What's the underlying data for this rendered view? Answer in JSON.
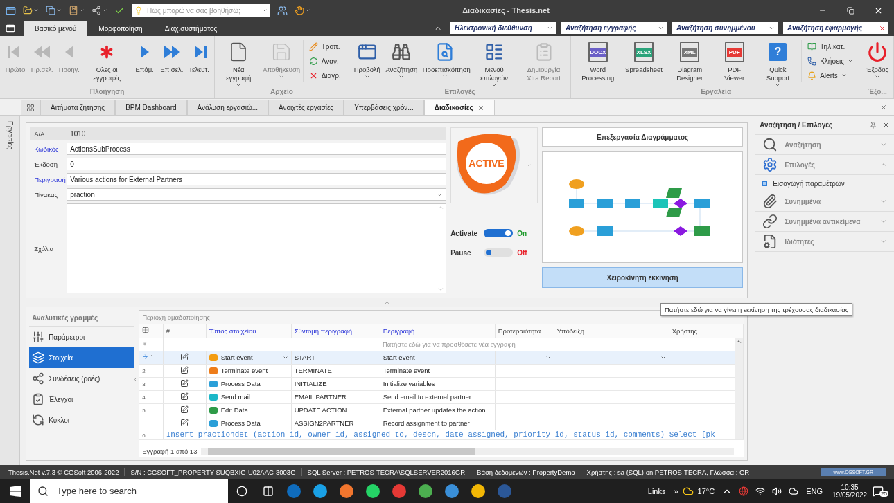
{
  "title_bar": {
    "search": {
      "placeholder": "Πως μπορώ να σας βοηθήσω;"
    },
    "title": "Διαδικασίες - Thesis.net"
  },
  "ribbon_tabs": [
    {
      "label": "Βασικό μενού",
      "selected": true
    },
    {
      "label": "Μορφοποίηση",
      "selected": false
    },
    {
      "label": "Διαχ.συστήματος",
      "selected": false
    }
  ],
  "ribbon_searches": [
    {
      "placeholder": "Ηλεκτρονική διεύθυνση",
      "kind": "dropdown"
    },
    {
      "placeholder": "Αναζήτηση εγγραφής",
      "kind": "dropdown"
    },
    {
      "placeholder": "Αναζήτηση συνημμένου",
      "kind": "dropdown"
    },
    {
      "placeholder": "Αναζήτηση εφαρμογής",
      "kind": "clear"
    }
  ],
  "ribbon_groups": [
    {
      "title": "Πλοήγηση",
      "items": [
        {
          "kind": "large",
          "label": "Πρώτο",
          "disabled": true,
          "dropdown": false
        },
        {
          "kind": "large",
          "label": "Πρ.σελ.",
          "disabled": true,
          "dropdown": false
        },
        {
          "kind": "large",
          "label": "Προηγ.",
          "disabled": true,
          "dropdown": false
        },
        {
          "kind": "large",
          "label": "Όλες οι εγγραφές",
          "disabled": false,
          "dropdown": false
        },
        {
          "kind": "large",
          "label": "Επόμ.",
          "disabled": false,
          "dropdown": false
        },
        {
          "kind": "large",
          "label": "Επ.σελ.",
          "disabled": false,
          "dropdown": false
        },
        {
          "kind": "large",
          "label": "Τελευτ.",
          "disabled": false,
          "dropdown": false
        }
      ]
    },
    {
      "title": "Αρχείο",
      "items": [
        {
          "kind": "large",
          "label": "Νέα εγγραφή",
          "disabled": false,
          "dropdown": true
        },
        {
          "kind": "large",
          "label": "Αποθήκευση",
          "disabled": true,
          "dropdown": true
        },
        {
          "kind": "small",
          "label": "Τροπ.",
          "disabled": false,
          "dropdown": false
        },
        {
          "kind": "small",
          "label": "Αναν.",
          "disabled": false,
          "dropdown": false
        },
        {
          "kind": "small",
          "label": "Διαγρ.",
          "disabled": false,
          "dropdown": false
        }
      ]
    },
    {
      "title": "Επιλογές",
      "items": [
        {
          "kind": "large",
          "label": "Προβολή",
          "disabled": false,
          "dropdown": true
        },
        {
          "kind": "large",
          "label": "Αναζήτηση",
          "disabled": false,
          "dropdown": true
        },
        {
          "kind": "large",
          "label": "Προεπισκόπηση",
          "disabled": false,
          "dropdown": true
        },
        {
          "kind": "large",
          "label": "Μενού επιλογών",
          "disabled": false,
          "dropdown": true
        },
        {
          "kind": "large",
          "label": "Δημιουργία Xtra Report",
          "disabled": true,
          "dropdown": false
        }
      ]
    },
    {
      "title": "Εργαλεία",
      "items": [
        {
          "kind": "large",
          "label": "Word Processing",
          "badge": "DOCX",
          "disabled": false,
          "dropdown": false
        },
        {
          "kind": "large",
          "label": "Spreadsheet",
          "badge": "XLSX",
          "disabled": false,
          "dropdown": false
        },
        {
          "kind": "large",
          "label": "Diagram Designer",
          "badge": "XML",
          "disabled": false,
          "dropdown": false
        },
        {
          "kind": "large",
          "label": "PDF Viewer",
          "badge": "PDF",
          "disabled": false,
          "dropdown": false
        },
        {
          "kind": "large",
          "label": "Quick Support",
          "badge": "?",
          "disabled": false,
          "dropdown": true
        },
        {
          "kind": "small",
          "label": "Τηλ.κατ.",
          "disabled": false,
          "dropdown": false
        },
        {
          "kind": "small",
          "label": "Κλήσεις",
          "disabled": false,
          "dropdown": true
        },
        {
          "kind": "small",
          "label": "Alerts",
          "disabled": false,
          "dropdown": true
        }
      ]
    },
    {
      "title": "Έξο...",
      "items": [
        {
          "kind": "large",
          "label": "Έξοδος",
          "disabled": false,
          "dropdown": true
        }
      ]
    }
  ],
  "side_strip": {
    "label": "Εργασίες"
  },
  "document_tabs": [
    {
      "label": "Αιτήματα ζήτησης",
      "selected": false
    },
    {
      "label": "BPM Dashboard",
      "selected": false
    },
    {
      "label": "Ανάλυση εργασιώ...",
      "selected": false
    },
    {
      "label": "Ανοιχτές εργασίες",
      "selected": false
    },
    {
      "label": "Υπερβάσεις χρόν...",
      "selected": false
    },
    {
      "label": "Διαδικασίες",
      "selected": true
    }
  ],
  "form": {
    "fields": [
      {
        "label": "A/A",
        "value": "1010",
        "kind": "readonly",
        "link": false
      },
      {
        "label": "Κωδικός",
        "value": "ActionsSubProcess",
        "kind": "text",
        "link": true
      },
      {
        "label": "Έκδοση",
        "value": "0",
        "kind": "text",
        "link": false
      },
      {
        "label": "Περιγραφή",
        "value": "Various actions for External Partners",
        "kind": "text",
        "link": true
      },
      {
        "label": "Πίνακας",
        "value": "praction",
        "kind": "dropdown",
        "link": false
      },
      {
        "label": "Σχόλια",
        "kind": "memo",
        "link": false
      }
    ],
    "logo": {
      "text": "ACTIVE"
    },
    "switches": [
      {
        "label": "Activate",
        "on": true,
        "state": "On"
      },
      {
        "label": "Pause",
        "on": false,
        "state": "Off"
      }
    ],
    "diagram_button": "Επεξεργασία Διαγράμματος",
    "start_button": "Χειροκίνητη εκκίνηση",
    "tooltip": "Πατήστε εδώ για να γίνει η εκκίνηση της τρέχουσας διαδικασίας"
  },
  "details": {
    "title": "Αναλυτικές γραμμές",
    "items": [
      {
        "label": "Παράμετροι",
        "selected": false
      },
      {
        "label": "Στοιχεία",
        "selected": true
      },
      {
        "label": "Συνδέσεις (ροές)",
        "selected": false
      },
      {
        "label": "Έλεγχοι",
        "selected": false
      },
      {
        "label": "Κύκλοι",
        "selected": false
      }
    ]
  },
  "grid": {
    "group_area": "Περιοχή ομαδοποίησης",
    "new_row": "Πατήστε εδώ για να προσθέσετε νέα εγγραφή",
    "footer": "Εγγραφή 1 από 13",
    "columns": [
      {
        "label": "#",
        "link": false
      },
      {
        "label": "Τύπος στοιχείου",
        "link": true
      },
      {
        "label": "Σύντομη περιγραφή",
        "link": true
      },
      {
        "label": "Περιγραφή",
        "link": true
      },
      {
        "label": "Προτεραιότητα",
        "link": false
      },
      {
        "label": "Υπόδειξη",
        "link": false
      },
      {
        "label": "Χρήστης",
        "link": false
      }
    ],
    "rows": [
      {
        "kind": "item",
        "number": "1",
        "current": true,
        "type": "Start event",
        "color": "#f39c12",
        "short": "START",
        "description": "Start event"
      },
      {
        "kind": "item",
        "number": "2",
        "current": false,
        "type": "Terminate event",
        "color": "#ee7d1a",
        "short": "TERMINATE",
        "description": "Terminate event"
      },
      {
        "kind": "item",
        "number": "3",
        "current": false,
        "type": "Process Data",
        "color": "#2a9fd8",
        "short": "INITIALIZE",
        "description": "Initialize variables"
      },
      {
        "kind": "item",
        "number": "4",
        "current": false,
        "type": "Send mail",
        "color": "#1bb8c8",
        "short": "EMAIL PARTNER",
        "description": "Send email to external partner"
      },
      {
        "kind": "item",
        "number": "5",
        "current": false,
        "type": "Edit Data",
        "color": "#2e9b48",
        "short": "UPDATE ACTION",
        "description": "External partner updates the action"
      },
      {
        "kind": "item",
        "current": false,
        "type": "Process Data",
        "color": "#2a9fd8",
        "short": "ASSIGN2PARTNER",
        "description": "Record assignment to partner"
      },
      {
        "kind": "sql",
        "number": "6",
        "text": "Insert practiondet (action_id, owner_id, assigned_to, descn, date_assigned, priority_id, status_id, comments) Select [pk"
      }
    ]
  },
  "side_panel": {
    "title": "Αναζήτηση / Επιλογές",
    "sections": [
      {
        "label": "Αναζήτηση",
        "expanded": false
      },
      {
        "label": "Επιλογές",
        "expanded": true,
        "children": [
          "Εισαγωγή παραμέτρων"
        ]
      },
      {
        "label": "Συνημμένα",
        "expanded": false
      },
      {
        "label": "Συνημμένα αντικείμενα",
        "expanded": false
      },
      {
        "label": "Ιδιότητες",
        "expanded": false
      }
    ]
  },
  "status_bar": {
    "items": [
      "Thesis.Net v.7.3 © CGSoft 2006-2022",
      "S/N : CGSOFT_PROPERTY-SUQBXIG-U02AAC-3003G",
      "SQL Server : PETROS-TECRA\\SQLSERVER2016GR",
      "Βάση δεδομένων : PropertyDemo",
      "Χρήστης : sa (SQL) on PETROS-TECRA, Γλώσσα : GR"
    ],
    "logo": "www.CGSOFT.GR"
  },
  "taskbar": {
    "search": {
      "placeholder": "Type here to search"
    },
    "links": "Links",
    "links_more": "»",
    "temperature": "17°C",
    "language": "ENG",
    "time": "10:35",
    "date": "19/05/2022",
    "notifications": "25"
  }
}
